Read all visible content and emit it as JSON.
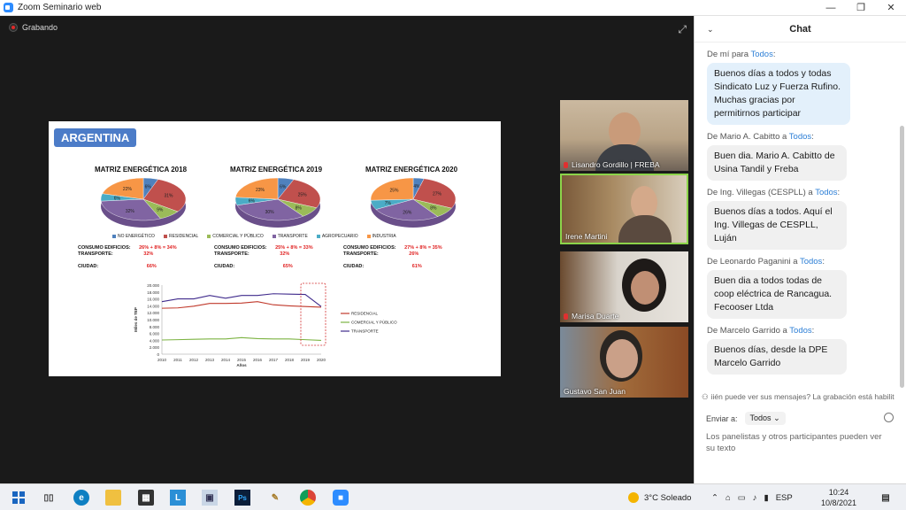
{
  "window": {
    "title": "Zoom Seminario web"
  },
  "meeting": {
    "recording_label": "Grabando"
  },
  "slide": {
    "country": "ARGENTINA",
    "charts": [
      {
        "title": "MATRIZ ENERGÉTICA 2018",
        "labels": [
          "6%",
          "31%",
          "9%",
          "32%",
          "6%",
          "22%"
        ],
        "consumo": "26% + 8% = 34%",
        "transporte": "32%",
        "ciudad": "66%"
      },
      {
        "title": "MATRIZ ENERGÉTICA 2019",
        "labels": [
          "6%",
          "25%",
          "8%",
          "30%",
          "6%",
          "23%"
        ],
        "consumo": "25% + 8% = 33%",
        "transporte": "32%",
        "ciudad": "65%"
      },
      {
        "title": "MATRIZ ENERGÉTICA 2020",
        "labels": [
          "4%",
          "27%",
          "8%",
          "26%",
          "7%",
          "25%"
        ],
        "consumo": "27% + 8% = 35%",
        "transporte": "26%",
        "ciudad": "61%"
      }
    ],
    "legend": [
      "NO ENERGÉTICO",
      "RESIDENCIAL",
      "COMERCIAL Y PÚBLICO",
      "TRANSPORTE",
      "AGROPECUARIO",
      "INDUSTRIA"
    ],
    "legend_colors": [
      "#4f81bd",
      "#c0504d",
      "#9bbb59",
      "#8064a2",
      "#4bacc6",
      "#f79646"
    ],
    "metric_labels": {
      "consumo": "CONSUMO EDIFICIOS:",
      "transporte": "TRANSPORTE:",
      "ciudad": "CIUDAD:"
    }
  },
  "chart_data": {
    "type": "line",
    "x": [
      2010,
      2011,
      2012,
      2013,
      2014,
      2015,
      2016,
      2017,
      2018,
      2019,
      2020
    ],
    "ylim": [
      0,
      20000
    ],
    "yticks": [
      "20.000",
      "18.000",
      "16.000",
      "14.000",
      "12.000",
      "10.000",
      "8.000",
      "6.000",
      "4.000",
      "2.000",
      "0"
    ],
    "xlabel": "Años",
    "ylabel": "Miles de TEP",
    "series": [
      {
        "name": "RESIDENCIAL",
        "color": "#c0392b",
        "values": [
          13300,
          13400,
          13900,
          14700,
          14700,
          14800,
          15200,
          14300,
          14000,
          13800,
          13600
        ]
      },
      {
        "name": "COMERCIAL Y PÚBLICO",
        "color": "#7cb342",
        "values": [
          4100,
          4200,
          4300,
          4400,
          4400,
          4800,
          4500,
          4400,
          4400,
          4200,
          4000
        ]
      },
      {
        "name": "TRANSPORTE",
        "color": "#3f2a8c",
        "values": [
          15200,
          16000,
          16000,
          17000,
          16200,
          17000,
          17000,
          17500,
          17400,
          17300,
          13800
        ]
      }
    ]
  },
  "participants": [
    {
      "name": "Lisandro Gordillo | FREBA",
      "muted": true
    },
    {
      "name": "Irene Martini",
      "muted": false
    },
    {
      "name": "Marisa Duarte",
      "muted": true
    },
    {
      "name": "Gustavo San Juan",
      "muted": false
    }
  ],
  "chat": {
    "title": "Chat",
    "to_label": "a",
    "to_target": "Todos",
    "messages": [
      {
        "from": "De mí para",
        "to": "Todos",
        "text": "Buenos días a todos y todas Sindicato Luz y Fuerza Rufino. Muchas gracias por permitirnos participar",
        "mine": true
      },
      {
        "from": "De Mario A. Cabitto",
        "to": "Todos",
        "text": "Buen dia. Mario A. Cabitto de Usina Tandil y Freba",
        "mine": false
      },
      {
        "from": "De Ing. Villegas (CESPLL)",
        "to": "Todos",
        "text": "Buenos días a todos. Aquí el Ing. Villegas de CESPLL, Luján",
        "mine": false
      },
      {
        "from": "De Leonardo Paganini",
        "to": "Todos",
        "text": "Buen dia a todos todas de coop eléctrica de Rancagua. Fecooser Ltda",
        "mine": false
      },
      {
        "from": "De Marcelo Garrido",
        "to": "Todos",
        "text": "Buenos días, desde la DPE Marcelo Garrido",
        "mine": false
      }
    ],
    "notice": "iién puede ver sus mensajes? La grabación está habilit",
    "send_to_label": "Enviar a:",
    "send_to_value": "Todos",
    "placeholder": "Los panelistas y otros participantes pueden ver su texto"
  },
  "taskbar": {
    "weather": "3°C  Soleado",
    "lang": "ESP",
    "time": "10:24",
    "date": "10/8/2021"
  }
}
